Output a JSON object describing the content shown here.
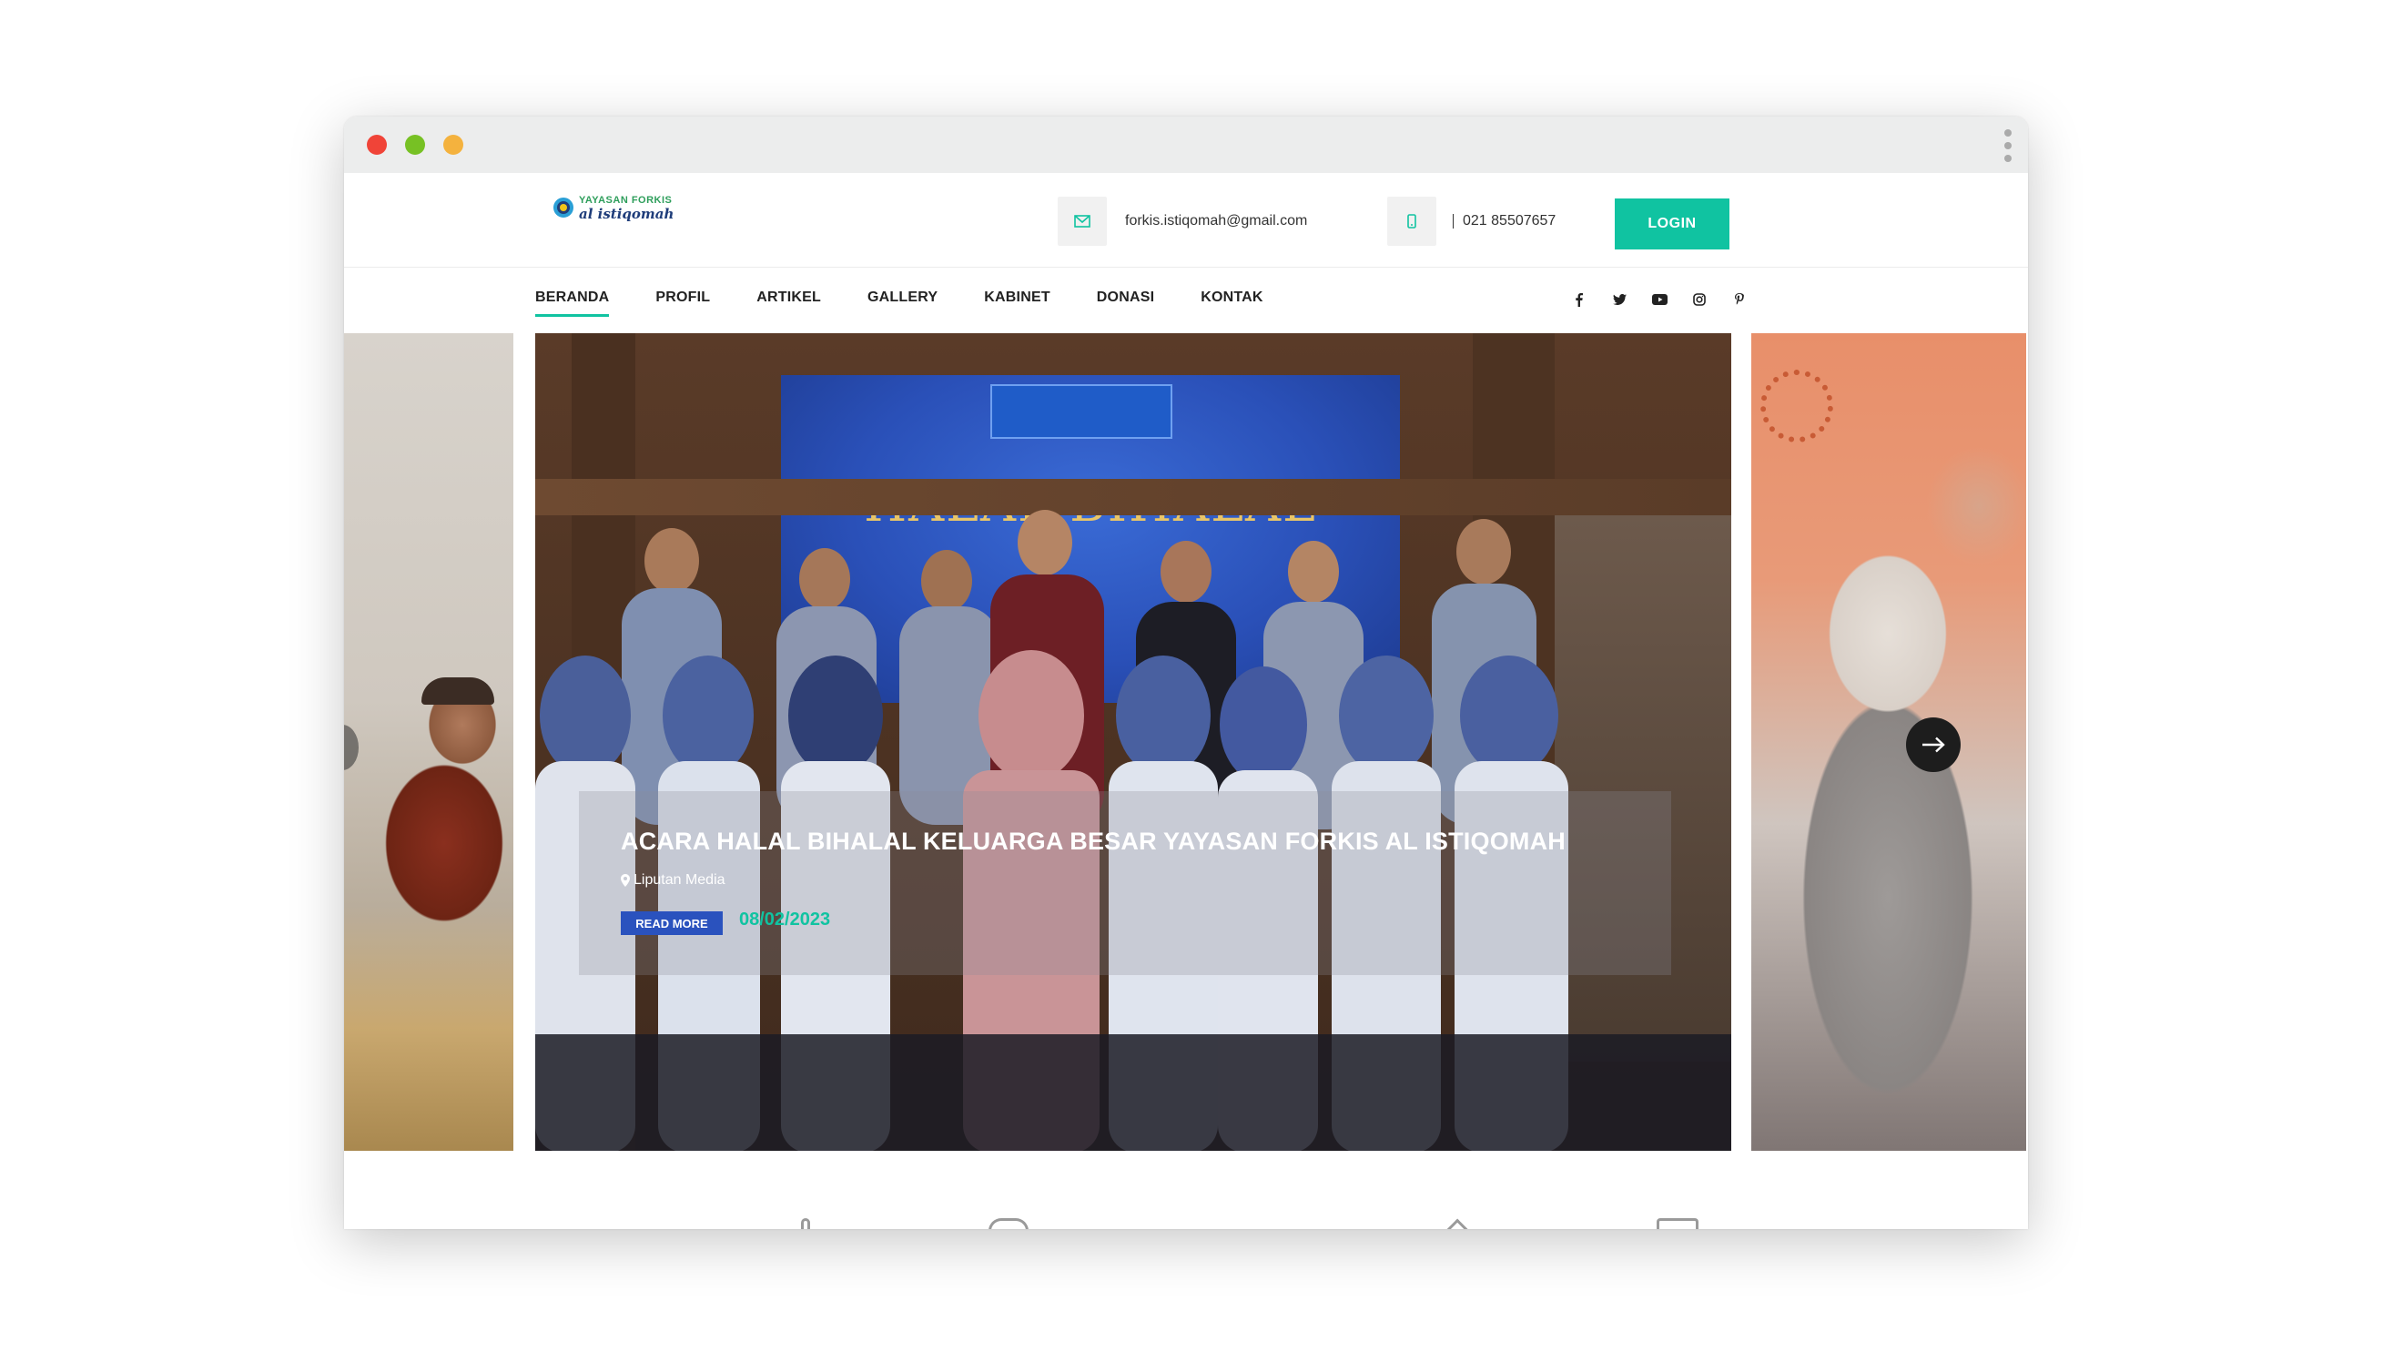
{
  "site": {
    "logo_line1": "YAYASAN FORKIS",
    "logo_line2": "al istiqomah"
  },
  "contact": {
    "email": "forkis.istiqomah@gmail.com",
    "phone": "021 85507657"
  },
  "header": {
    "login_label": "LOGIN"
  },
  "nav": {
    "items": [
      {
        "label": "BERANDA",
        "active": true
      },
      {
        "label": "PROFIL"
      },
      {
        "label": "ARTIKEL"
      },
      {
        "label": "GALLERY"
      },
      {
        "label": "KABINET"
      },
      {
        "label": "DONASI"
      },
      {
        "label": "KONTAK"
      }
    ]
  },
  "social": [
    "facebook-icon",
    "twitter-icon",
    "youtube-icon",
    "instagram-icon",
    "pinterest-icon"
  ],
  "slide": {
    "banner_title": "HALAL BIHALAL",
    "title": "ACARA HALAL BIHALAL KELUARGA BESAR YAYASAN FORKIS AL ISTIQOMAH",
    "category": "Liputan Media",
    "read_more": "READ MORE",
    "date": "08/02/2023"
  },
  "colors": {
    "accent": "#10c3a1",
    "read_more_bg": "#2a52be"
  }
}
